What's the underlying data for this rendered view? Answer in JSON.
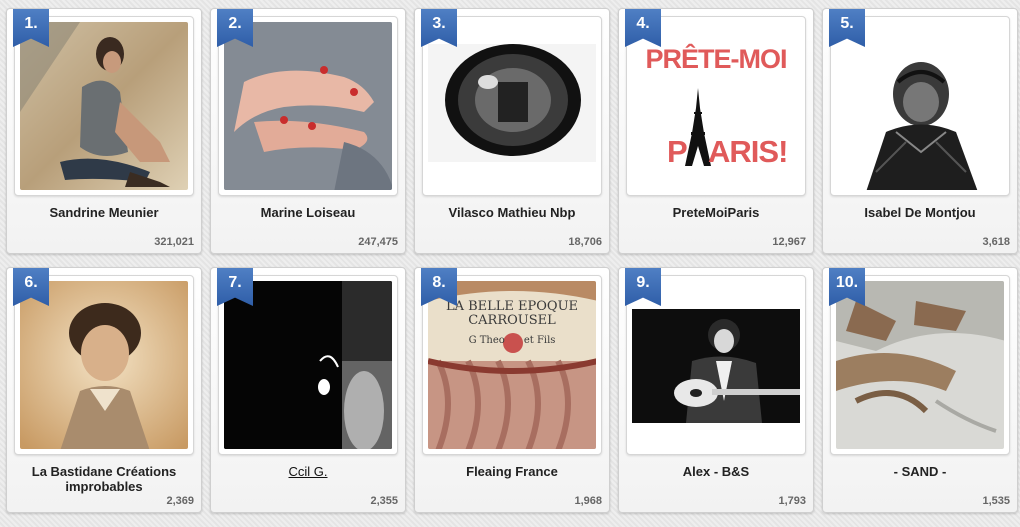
{
  "items": [
    {
      "rank": "1.",
      "name": "Sandrine Meunier",
      "count": "321,021",
      "icon": "photo-beach-woman"
    },
    {
      "rank": "2.",
      "name": "Marine Loiseau",
      "count": "247,475",
      "icon": "photo-hands"
    },
    {
      "rank": "3.",
      "name": "Vilasco Mathieu Nbp",
      "count": "18,706",
      "icon": "photo-mirror"
    },
    {
      "rank": "4.",
      "name": "PreteMoiParis",
      "count": "12,967",
      "icon": "logo-pretemoiparis",
      "logo_top": "PRÊTE-MOI",
      "logo_bottom": "ARIS!",
      "logo_p": "P"
    },
    {
      "rank": "5.",
      "name": "Isabel De Montjou",
      "count": "3,618",
      "icon": "illustration-portrait"
    },
    {
      "rank": "6.",
      "name": "La Bastidane Créations improbables",
      "count": "2,369",
      "icon": "photo-vintage-portrait"
    },
    {
      "rank": "7.",
      "name": "Ccil G.",
      "count": "2,355",
      "icon": "photo-dark-doorway"
    },
    {
      "rank": "8.",
      "name": "Fleaing France",
      "count": "1,968",
      "icon": "photo-carousel",
      "sign_line1": "LA BELLE EPOQUE",
      "sign_line2": "CARROUSEL",
      "sign_line3": "G Theo      et Fils"
    },
    {
      "rank": "9.",
      "name": "Alex - B&S",
      "count": "1,793",
      "icon": "photo-guitarist"
    },
    {
      "rank": "10.",
      "name": "- SAND -",
      "count": "1,535",
      "icon": "painting-feet"
    }
  ],
  "colors": {
    "ribbon": "#3a6bb5",
    "logo_red": "#e05a5a"
  }
}
